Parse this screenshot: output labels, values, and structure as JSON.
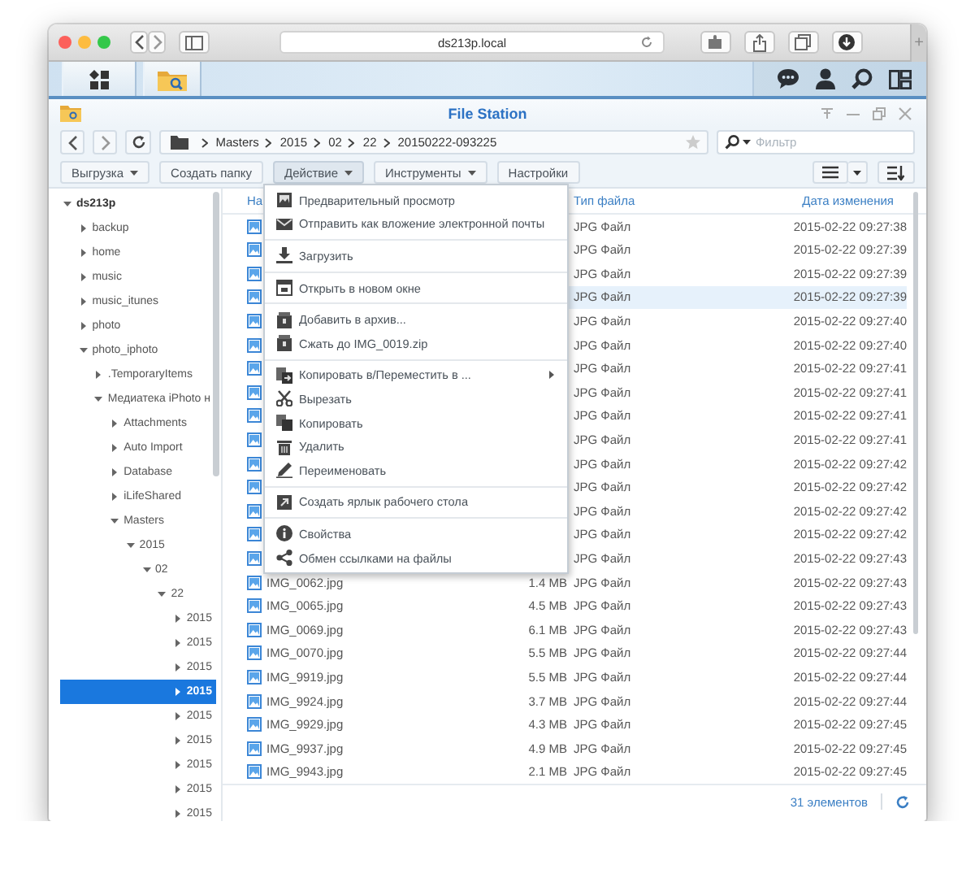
{
  "browser": {
    "address": "ds213p.local",
    "new_tab": "+"
  },
  "app": {
    "title": "File Station",
    "path": [
      "Masters",
      "2015",
      "02",
      "22",
      "20150222-093225"
    ],
    "filter": {
      "placeholder": "Фильтр"
    }
  },
  "toolbar": [
    {
      "label": "Выгрузка",
      "dropdown": true,
      "selected": false
    },
    {
      "label": "Создать папку",
      "dropdown": false,
      "selected": false
    },
    {
      "label": "Действие",
      "dropdown": true,
      "selected": true
    },
    {
      "label": "Инструменты",
      "dropdown": true,
      "selected": false
    },
    {
      "label": "Настройки",
      "dropdown": false,
      "selected": false
    }
  ],
  "tree": [
    {
      "label": "ds213p",
      "expanded": true,
      "selected": false,
      "children": [
        {
          "label": "backup",
          "expanded": false,
          "selected": false
        },
        {
          "label": "home",
          "expanded": false,
          "selected": false
        },
        {
          "label": "music",
          "expanded": false,
          "selected": false
        },
        {
          "label": "music_itunes",
          "expanded": false,
          "selected": false
        },
        {
          "label": "photo",
          "expanded": false,
          "selected": false
        },
        {
          "label": "photo_iphoto",
          "expanded": true,
          "selected": false,
          "children": [
            {
              "label": ".TemporaryItems",
              "expanded": false,
              "selected": false
            },
            {
              "label": "Медиатека iPhoto н",
              "expanded": true,
              "selected": false,
              "children": [
                {
                  "label": "Attachments",
                  "expanded": false,
                  "selected": false
                },
                {
                  "label": "Auto Import",
                  "expanded": false,
                  "selected": false
                },
                {
                  "label": "Database",
                  "expanded": false,
                  "selected": false
                },
                {
                  "label": "iLifeShared",
                  "expanded": false,
                  "selected": false
                },
                {
                  "label": "Masters",
                  "expanded": true,
                  "selected": false,
                  "children": [
                    {
                      "label": "2015",
                      "expanded": true,
                      "selected": false,
                      "children": [
                        {
                          "label": "02",
                          "expanded": true,
                          "selected": false,
                          "children": [
                            {
                              "label": "22",
                              "expanded": true,
                              "selected": false,
                              "children": [
                                {
                                  "label": "2015",
                                  "expanded": false,
                                  "selected": false
                                },
                                {
                                  "label": "2015",
                                  "expanded": false,
                                  "selected": false
                                },
                                {
                                  "label": "2015",
                                  "expanded": false,
                                  "selected": false
                                },
                                {
                                  "label": "2015",
                                  "expanded": false,
                                  "selected": true
                                },
                                {
                                  "label": "2015",
                                  "expanded": false,
                                  "selected": false
                                },
                                {
                                  "label": "2015",
                                  "expanded": false,
                                  "selected": false
                                },
                                {
                                  "label": "2015",
                                  "expanded": false,
                                  "selected": false
                                },
                                {
                                  "label": "2015",
                                  "expanded": false,
                                  "selected": false
                                },
                                {
                                  "label": "2015",
                                  "expanded": false,
                                  "selected": false
                                }
                              ]
                            }
                          ]
                        }
                      ]
                    }
                  ]
                }
              ]
            }
          ]
        }
      ]
    }
  ],
  "list": {
    "columns": {
      "name": "На",
      "type": "Тип файла",
      "modified": "Дата изменения"
    },
    "rows": [
      {
        "type": "JPG Файл",
        "modified": "2015-02-22 09:27:38",
        "selected": false
      },
      {
        "type": "JPG Файл",
        "modified": "2015-02-22 09:27:39",
        "selected": false
      },
      {
        "type": "JPG Файл",
        "modified": "2015-02-22 09:27:39",
        "selected": false
      },
      {
        "type": "JPG Файл",
        "modified": "2015-02-22 09:27:39",
        "selected": true
      },
      {
        "type": "JPG Файл",
        "modified": "2015-02-22 09:27:40",
        "selected": false
      },
      {
        "type": "JPG Файл",
        "modified": "2015-02-22 09:27:40",
        "selected": false
      },
      {
        "type": "JPG Файл",
        "modified": "2015-02-22 09:27:41",
        "selected": false
      },
      {
        "type": "JPG Файл",
        "modified": "2015-02-22 09:27:41",
        "selected": false
      },
      {
        "type": "JPG Файл",
        "modified": "2015-02-22 09:27:41",
        "selected": false
      },
      {
        "type": "JPG Файл",
        "modified": "2015-02-22 09:27:41",
        "selected": false
      },
      {
        "type": "JPG Файл",
        "modified": "2015-02-22 09:27:42",
        "selected": false
      },
      {
        "type": "JPG Файл",
        "modified": "2015-02-22 09:27:42",
        "selected": false
      },
      {
        "type": "JPG Файл",
        "modified": "2015-02-22 09:27:42",
        "selected": false
      },
      {
        "type": "JPG Файл",
        "modified": "2015-02-22 09:27:42",
        "selected": false
      },
      {
        "type": "JPG Файл",
        "modified": "2015-02-22 09:27:43",
        "selected": false
      },
      {
        "name": "IMG_0062.jpg",
        "size": "1.4 MB",
        "type": "JPG Файл",
        "modified": "2015-02-22 09:27:43",
        "selected": false
      },
      {
        "name": "IMG_0065.jpg",
        "size": "4.5 MB",
        "type": "JPG Файл",
        "modified": "2015-02-22 09:27:43",
        "selected": false
      },
      {
        "name": "IMG_0069.jpg",
        "size": "6.1 MB",
        "type": "JPG Файл",
        "modified": "2015-02-22 09:27:43",
        "selected": false
      },
      {
        "name": "IMG_0070.jpg",
        "size": "5.5 MB",
        "type": "JPG Файл",
        "modified": "2015-02-22 09:27:44",
        "selected": false
      },
      {
        "name": "IMG_9919.jpg",
        "size": "5.5 MB",
        "type": "JPG Файл",
        "modified": "2015-02-22 09:27:44",
        "selected": false
      },
      {
        "name": "IMG_9924.jpg",
        "size": "3.7 MB",
        "type": "JPG Файл",
        "modified": "2015-02-22 09:27:44",
        "selected": false
      },
      {
        "name": "IMG_9929.jpg",
        "size": "4.3 MB",
        "type": "JPG Файл",
        "modified": "2015-02-22 09:27:45",
        "selected": false
      },
      {
        "name": "IMG_9937.jpg",
        "size": "4.9 MB",
        "type": "JPG Файл",
        "modified": "2015-02-22 09:27:45",
        "selected": false
      },
      {
        "name": "IMG_9943.jpg",
        "size": "2.1 MB",
        "type": "JPG Файл",
        "modified": "2015-02-22 09:27:45",
        "selected": false
      }
    ],
    "status": "31 элементов"
  },
  "menu": {
    "groups": [
      [
        {
          "label": "Предварительный просмотр",
          "submenu": false
        },
        {
          "label": "Отправить как вложение электронной почты",
          "submenu": false
        }
      ],
      [
        {
          "label": "Загрузить",
          "submenu": false
        }
      ],
      [
        {
          "label": "Открыть в новом окне",
          "submenu": false
        }
      ],
      [
        {
          "label": "Добавить в архив...",
          "submenu": false
        },
        {
          "label": "Сжать до IMG_0019.zip",
          "submenu": false
        }
      ],
      [
        {
          "label": "Копировать в/Переместить в ...",
          "submenu": true
        },
        {
          "label": "Вырезать",
          "submenu": false
        },
        {
          "label": "Копировать",
          "submenu": false
        },
        {
          "label": "Удалить",
          "submenu": false
        },
        {
          "label": "Переименовать",
          "submenu": false
        }
      ],
      [
        {
          "label": "Создать ярлык рабочего стола",
          "submenu": false
        }
      ],
      [
        {
          "label": "Свойства",
          "submenu": false
        },
        {
          "label": "Обмен ссылками на файлы",
          "submenu": false
        }
      ]
    ]
  }
}
